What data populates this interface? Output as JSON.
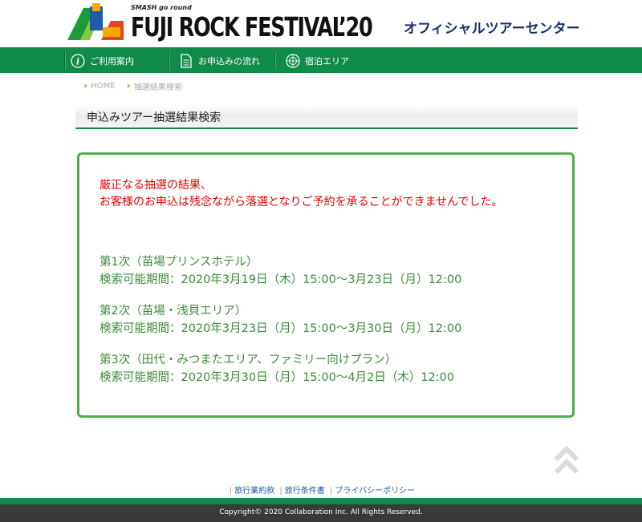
{
  "header": {
    "logo_tagline": "SMASH go round",
    "logo_title": "FUJI ROCK FESTIVAL’20",
    "subtitle": "オフィシャルツアーセンター"
  },
  "nav": {
    "items": [
      {
        "label": "ご利用案内",
        "icon": "info-icon"
      },
      {
        "label": "お申込みの流れ",
        "icon": "document-icon"
      },
      {
        "label": "宿泊エリア",
        "icon": "map-icon"
      }
    ]
  },
  "breadcrumb": {
    "home": "HOME",
    "current": "抽選結果検索"
  },
  "page_title": "申込みツアー抽選結果検索",
  "result": {
    "message_line1": "厳正なる抽選の結果、",
    "message_line2": "お客様のお申込は残念ながら落選となりご予約を承ることができませんでした。",
    "periods": [
      {
        "name": "第1次（苗場プリンスホテル）",
        "period": "検索可能期間：2020年3月19日（木）15:00〜3月23日（月）12:00"
      },
      {
        "name": "第2次（苗場・浅貝エリア）",
        "period": "検索可能期間：2020年3月23日（月）15:00〜3月30日（月）12:00"
      },
      {
        "name": "第3次（田代・みつまたエリア、ファミリー向けプラン）",
        "period": "検索可能期間：2020年3月30日（月）15:00〜4月2日（木）12:00"
      }
    ]
  },
  "footer": {
    "links": [
      "旅行業約款",
      "旅行条件書",
      "プライバシーポリシー"
    ],
    "copyright": "Copyright© 2020 Collaboration Inc. All Rights Reserved."
  },
  "colors": {
    "brand_green": "#118b4a",
    "alert_red": "#e60000",
    "period_green": "#3c8a3c",
    "box_border": "#4cae4c"
  }
}
